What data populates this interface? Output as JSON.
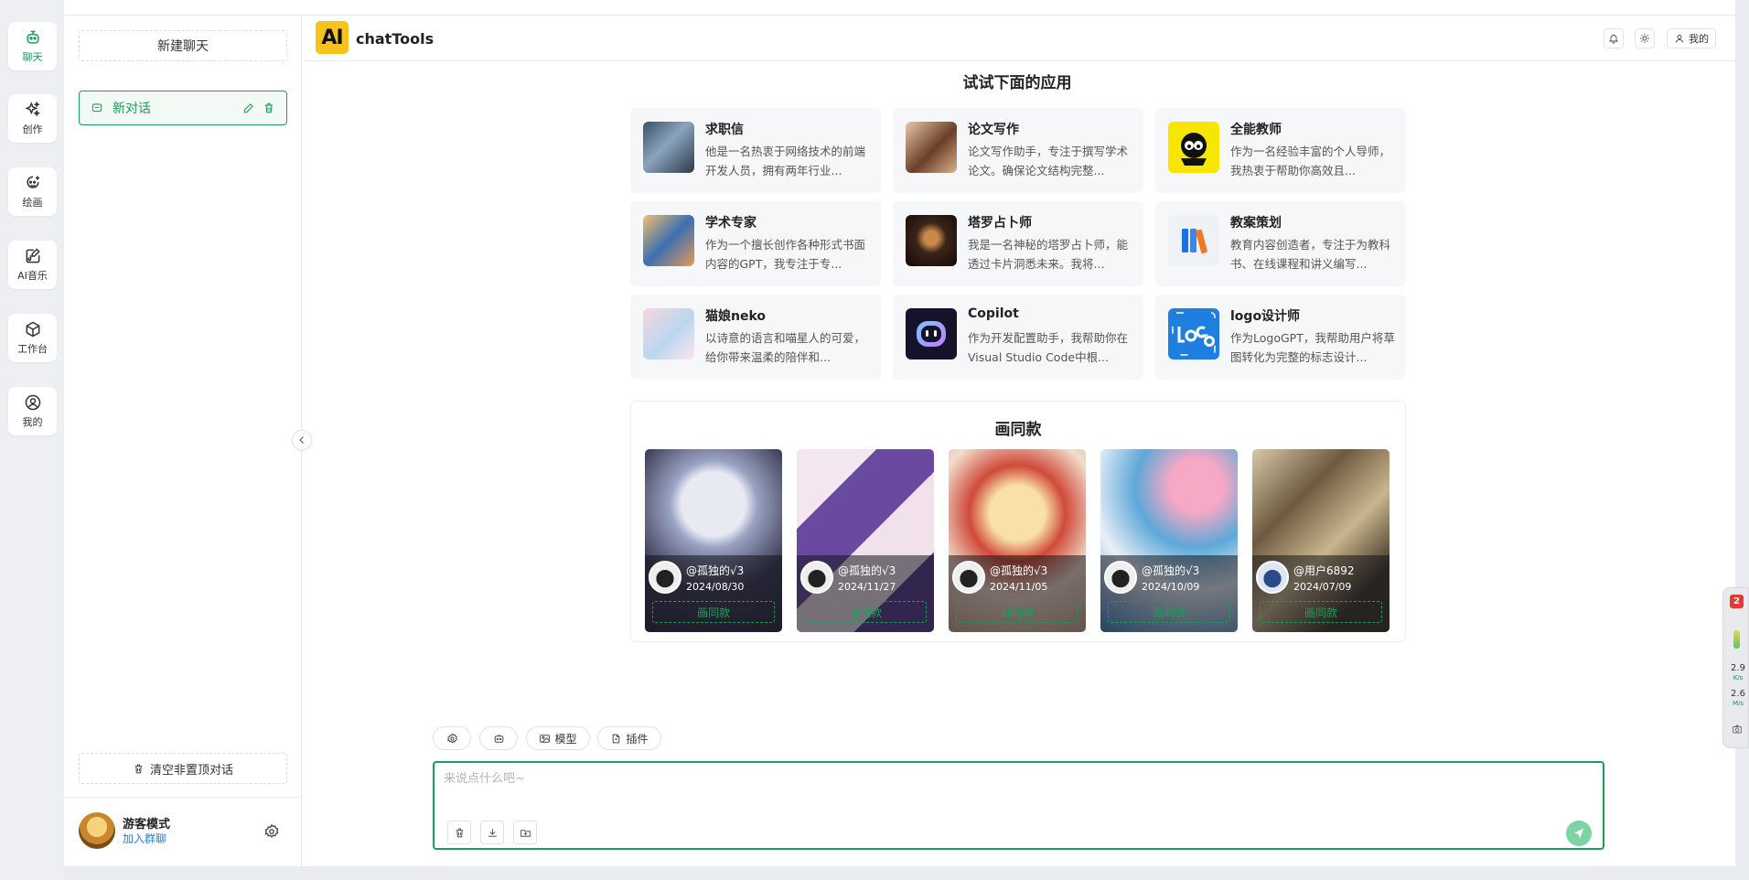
{
  "rail": {
    "items": [
      {
        "label": "聊天",
        "icon": "chat-robot-icon",
        "active": true
      },
      {
        "label": "创作",
        "icon": "sparkles-icon",
        "active": false
      },
      {
        "label": "绘画",
        "icon": "image-draw-icon",
        "active": false
      },
      {
        "label": "AI音乐",
        "icon": "music-edit-icon",
        "active": false
      },
      {
        "label": "工作台",
        "icon": "cube-icon",
        "active": false
      },
      {
        "label": "我的",
        "icon": "user-circle-icon",
        "active": false
      }
    ]
  },
  "sidebar": {
    "new_chat_label": "新建聊天",
    "conversations": [
      {
        "title": "新对话"
      }
    ],
    "clear_label": "清空非置顶对话",
    "user": {
      "name": "游客模式",
      "link": "加入群聊"
    }
  },
  "header": {
    "logo_text": "AI",
    "app_title": "chatTools",
    "my_label": "我的"
  },
  "apps_section": {
    "title": "试试下面的应用",
    "apps": [
      {
        "name": "求职信",
        "desc": "他是一名热衷于网络技术的前端开发人员，拥有两年行业..."
      },
      {
        "name": "论文写作",
        "desc": "论文写作助手，专注于撰写学术论文。确保论文结构完整..."
      },
      {
        "name": "全能教师",
        "desc": "作为一名经验丰富的个人导师，我热衷于帮助你高效且..."
      },
      {
        "name": "学术专家",
        "desc": "作为一个擅长创作各种形式书面内容的GPT，我专注于专..."
      },
      {
        "name": "塔罗占卜师",
        "desc": "我是一名神秘的塔罗占卜师，能透过卡片洞悉未来。我将..."
      },
      {
        "name": "教案策划",
        "desc": "教育内容创造者，专注于为教科书、在线课程和讲义编写..."
      },
      {
        "name": "猫娘neko",
        "desc": "以诗意的语言和喵星人的可爱，给你带来温柔的陪伴和..."
      },
      {
        "name": "Copilot",
        "desc": "作为开发配置助手，我帮助你在Visual Studio Code中根..."
      },
      {
        "name": "logo设计师",
        "desc": "作为LogoGPT，我帮助用户将草图转化为完整的标志设计..."
      }
    ]
  },
  "gallery": {
    "title": "画同款",
    "items": [
      {
        "user": "@孤独的√3",
        "date": "2024/08/30",
        "button": "画同款"
      },
      {
        "user": "@孤独的√3",
        "date": "2024/11/27",
        "button": "画同款"
      },
      {
        "user": "@孤独的√3",
        "date": "2024/11/05",
        "button": "画同款"
      },
      {
        "user": "@孤独的√3",
        "date": "2024/10/09",
        "button": "画同款"
      },
      {
        "user": "@用户6892",
        "date": "2024/07/09",
        "button": "画同款"
      }
    ]
  },
  "toolbar": {
    "model_label": "模型",
    "plugin_label": "插件"
  },
  "input": {
    "placeholder": "来说点什么吧~"
  },
  "widget": {
    "badge": "2",
    "stat1_value": "2.9",
    "stat1_unit": "K/s",
    "stat2_value": "2.6",
    "stat2_unit": "M/s"
  },
  "colors": {
    "accent": "#18a058",
    "logo_bg": "#f6c21c",
    "link": "#2080f0"
  }
}
